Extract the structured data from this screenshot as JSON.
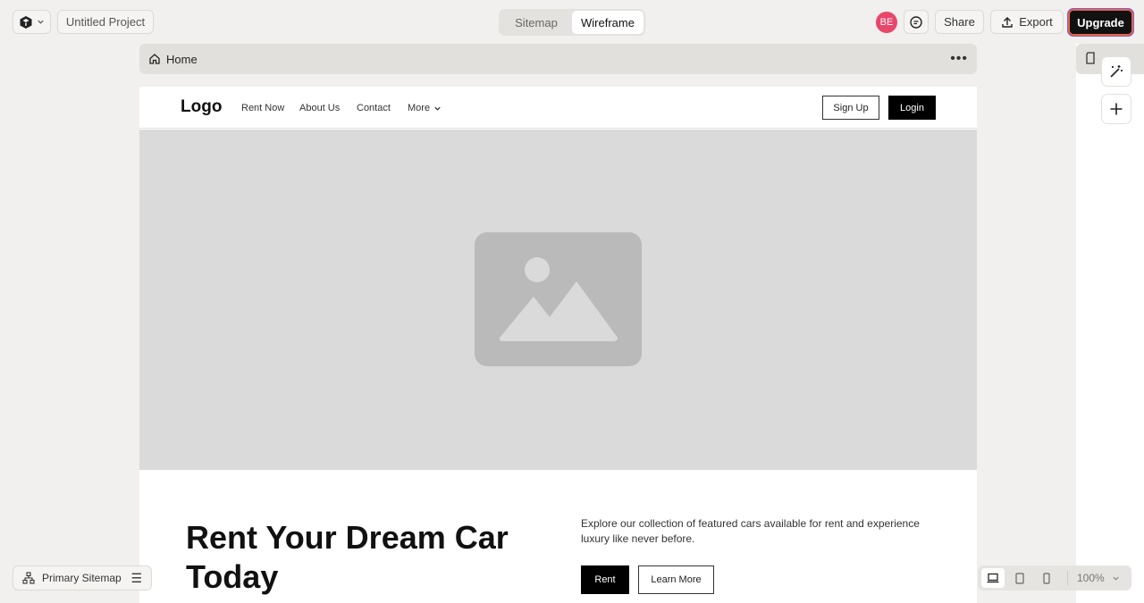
{
  "topbar": {
    "project_title": "Untitled Project",
    "view_tabs": [
      "Sitemap",
      "Wireframe"
    ],
    "active_view": "Wireframe",
    "avatar_initials": "BE",
    "share_label": "Share",
    "export_label": "Export",
    "upgrade_label": "Upgrade"
  },
  "page_bar": {
    "title": "Home"
  },
  "wireframe": {
    "nav": {
      "logo": "Logo",
      "links": [
        "Rent Now",
        "About Us",
        "Contact",
        "More"
      ],
      "signup_label": "Sign Up",
      "login_label": "Login"
    },
    "hero": {
      "headline": "Rent Your Dream Car Today",
      "description": "Explore our collection of featured cars available for rent and experience luxury like never before.",
      "primary_label": "Rent",
      "secondary_label": "Learn More"
    }
  },
  "bottom": {
    "sitemap_label": "Primary Sitemap",
    "zoom": "100%"
  },
  "colors": {
    "avatar": "#e8466a",
    "upgrade_bg": "#111111",
    "canvas_bg": "#f1f0ee"
  }
}
